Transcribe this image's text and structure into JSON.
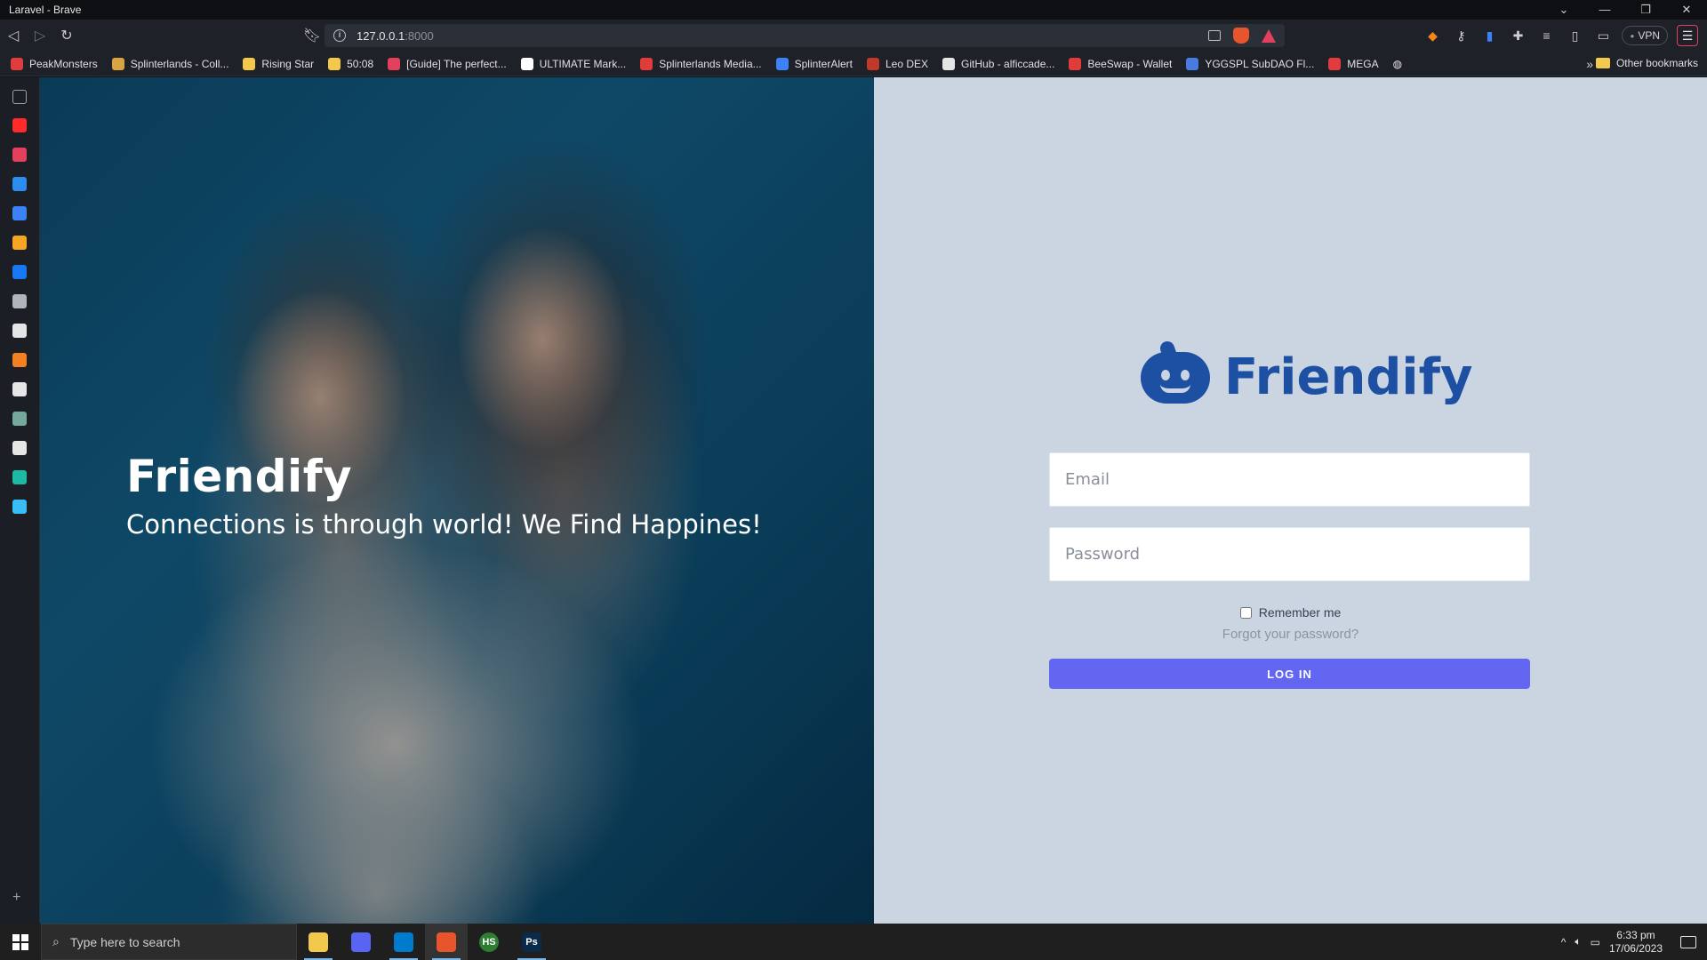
{
  "window": {
    "title": "Laravel - Brave",
    "controls": [
      "⌄",
      "—",
      "❐",
      "✕"
    ]
  },
  "address_bar": {
    "host": "127.0.0.1",
    "port": ":8000"
  },
  "extensions": {
    "vpn_label": "VPN",
    "menu_glyph": "☰"
  },
  "bookmarks": {
    "items": [
      {
        "label": "PeakMonsters",
        "color": "#e23b3b"
      },
      {
        "label": "Splinterlands - Coll...",
        "color": "#d9a441"
      },
      {
        "label": "Rising Star",
        "color": "#f2c94c"
      },
      {
        "label": "50:08",
        "color": "#f2c94c"
      },
      {
        "label": "[Guide] The perfect...",
        "color": "#e2405c"
      },
      {
        "label": "ULTIMATE Mark...",
        "color": "#ffffff"
      },
      {
        "label": "Splinterlands Media...",
        "color": "#e23b3b"
      },
      {
        "label": "SplinterAlert",
        "color": "#3b82f6"
      },
      {
        "label": "Leo DEX",
        "color": "#c0392b"
      },
      {
        "label": "GitHub - alficcade...",
        "color": "#e6e6e6"
      },
      {
        "label": "BeeSwap - Wallet",
        "color": "#e23b3b"
      },
      {
        "label": "YGGSPL SubDAO Fl...",
        "color": "#4a7be0"
      },
      {
        "label": "MEGA",
        "color": "#e23b3b"
      }
    ],
    "more_glyph": "»",
    "other": "Other bookmarks"
  },
  "sidebar": {
    "icons": [
      {
        "name": "sidebar-toggle-icon",
        "color": "#9ca0a8"
      },
      {
        "name": "youtube-icon",
        "color": "#ff2a2a"
      },
      {
        "name": "target-icon",
        "color": "#e2405c"
      },
      {
        "name": "z-app-icon",
        "color": "#2d8cf0"
      },
      {
        "name": "flag-icon",
        "color": "#3b82f6"
      },
      {
        "name": "hd-icon",
        "color": "#f5a623"
      },
      {
        "name": "facebook-icon",
        "color": "#1877f2"
      },
      {
        "name": "globe-icon",
        "color": "#b0b4bb"
      },
      {
        "name": "speaker-icon",
        "color": "#e6e6e6"
      },
      {
        "name": "stackoverflow-icon",
        "color": "#f48024"
      },
      {
        "name": "github-icon",
        "color": "#e6e6e6"
      },
      {
        "name": "chatgpt-icon",
        "color": "#74aa9c"
      },
      {
        "name": "notes-icon",
        "color": "#e6e6e6"
      },
      {
        "name": "leaf-icon",
        "color": "#1db9a4"
      },
      {
        "name": "tailwind-icon",
        "color": "#38bdf8"
      }
    ],
    "add_glyph": "+"
  },
  "hero": {
    "title": "Friendify",
    "subtitle": "Connections is through world! We Find Happines!"
  },
  "login": {
    "brand": "Friendify",
    "email_placeholder": "Email",
    "password_placeholder": "Password",
    "remember_label": "Remember me",
    "forgot_label": "Forgot your password?",
    "submit_label": "LOG IN",
    "accent_color": "#6366f1",
    "brand_color": "#1d4fa3"
  },
  "taskbar": {
    "search_placeholder": "Type here to search",
    "apps": [
      {
        "name": "file-explorer-icon",
        "label": "",
        "color": "#f2c94c"
      },
      {
        "name": "discord-icon",
        "label": "",
        "color": "#5865f2"
      },
      {
        "name": "vscode-icon",
        "label": "",
        "color": "#007acc"
      },
      {
        "name": "brave-icon",
        "label": "",
        "color": "#e8552c"
      },
      {
        "name": "hs-app-icon",
        "label": "HS",
        "color": "#2f7d32"
      },
      {
        "name": "photoshop-icon",
        "label": "Ps",
        "color": "#0a2a4a"
      }
    ],
    "tray_up": "^",
    "clock_time": "6:33 pm",
    "clock_date": "17/06/2023"
  }
}
